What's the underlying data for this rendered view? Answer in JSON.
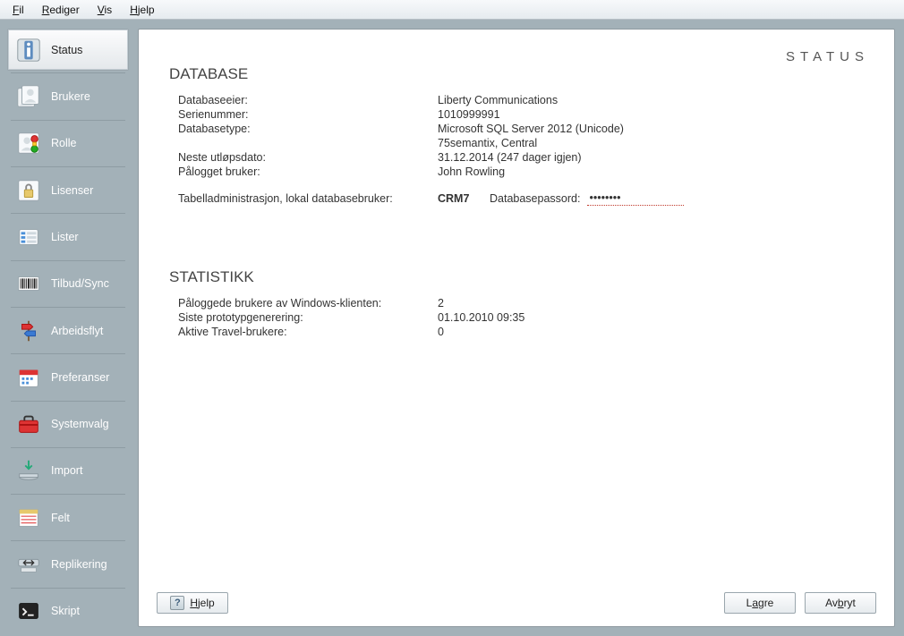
{
  "menubar": {
    "file": "Fil",
    "edit": "Rediger",
    "view": "Vis",
    "help": "Hjelp"
  },
  "sidebar": {
    "items": [
      {
        "key": "status",
        "label": "Status"
      },
      {
        "key": "brukere",
        "label": "Brukere"
      },
      {
        "key": "rolle",
        "label": "Rolle"
      },
      {
        "key": "lisenser",
        "label": "Lisenser"
      },
      {
        "key": "lister",
        "label": "Lister"
      },
      {
        "key": "tilbud",
        "label": "Tilbud/Sync"
      },
      {
        "key": "arbeidsflyt",
        "label": "Arbeidsflyt"
      },
      {
        "key": "preferanser",
        "label": "Preferanser"
      },
      {
        "key": "systemvalg",
        "label": "Systemvalg"
      },
      {
        "key": "import",
        "label": "Import"
      },
      {
        "key": "felt",
        "label": "Felt"
      },
      {
        "key": "replikering",
        "label": "Replikering"
      },
      {
        "key": "skript",
        "label": "Skript"
      }
    ]
  },
  "page": {
    "title": "STATUS"
  },
  "database": {
    "heading": "DATABASE",
    "owner_label": "Databaseeier:",
    "owner_value": "Liberty Communications",
    "serial_label": "Serienummer:",
    "serial_value": "1010999991",
    "type_label": "Databasetype:",
    "type_value_1": "Microsoft SQL Server 2012 (Unicode)",
    "type_value_2": "75semantix, Central",
    "expiry_label": "Neste utløpsdato:",
    "expiry_value": "31.12.2014 (247 dager igjen)",
    "user_label": "Pålogget bruker:",
    "user_value": "John Rowling",
    "tableadmin_label": "Tabelladministrasjon, lokal databasebruker:",
    "tableadmin_value": "CRM7",
    "password_label": "Databasepassord:",
    "password_value": "********"
  },
  "statistics": {
    "heading": "STATISTIKK",
    "logged_label": "Påloggede brukere av Windows-klienten:",
    "logged_value": "2",
    "proto_label": "Siste prototypgenerering:",
    "proto_value": "01.10.2010 09:35",
    "travel_label": "Aktive Travel-brukere:",
    "travel_value": "0"
  },
  "buttons": {
    "help": "Hjelp",
    "save": "Lagre",
    "cancel": "Avbryt"
  }
}
